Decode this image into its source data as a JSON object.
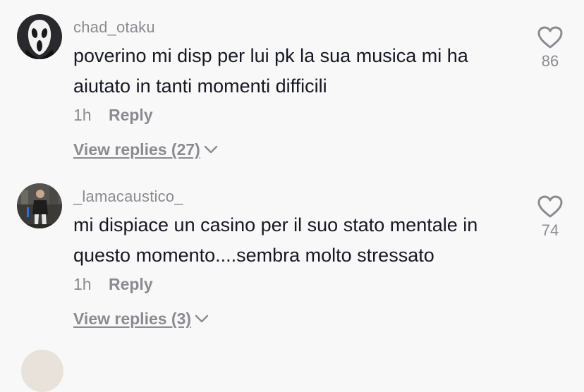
{
  "comments": [
    {
      "username": "chad_otaku",
      "text": "poverino mi disp per lui pk la sua musica mi ha aiutato in tanti momenti difficili",
      "time": "1h",
      "reply_label": "Reply",
      "view_replies": "View replies (27)",
      "likes": "86",
      "avatar_icon": "ghostface-mask-avatar"
    },
    {
      "username": "_lamacaustico_",
      "text": "mi dispiace un casino per il suo stato mentale in questo momento....sembra molto stressato",
      "time": "1h",
      "reply_label": "Reply",
      "view_replies": "View replies (3)",
      "likes": "74",
      "avatar_icon": "person-photo-avatar"
    }
  ],
  "icons": {
    "like": "heart-outline-icon",
    "expand": "chevron-down-icon"
  },
  "colors": {
    "background": "#f8f8f8",
    "text": "#161823",
    "secondary": "#8a8b91"
  }
}
